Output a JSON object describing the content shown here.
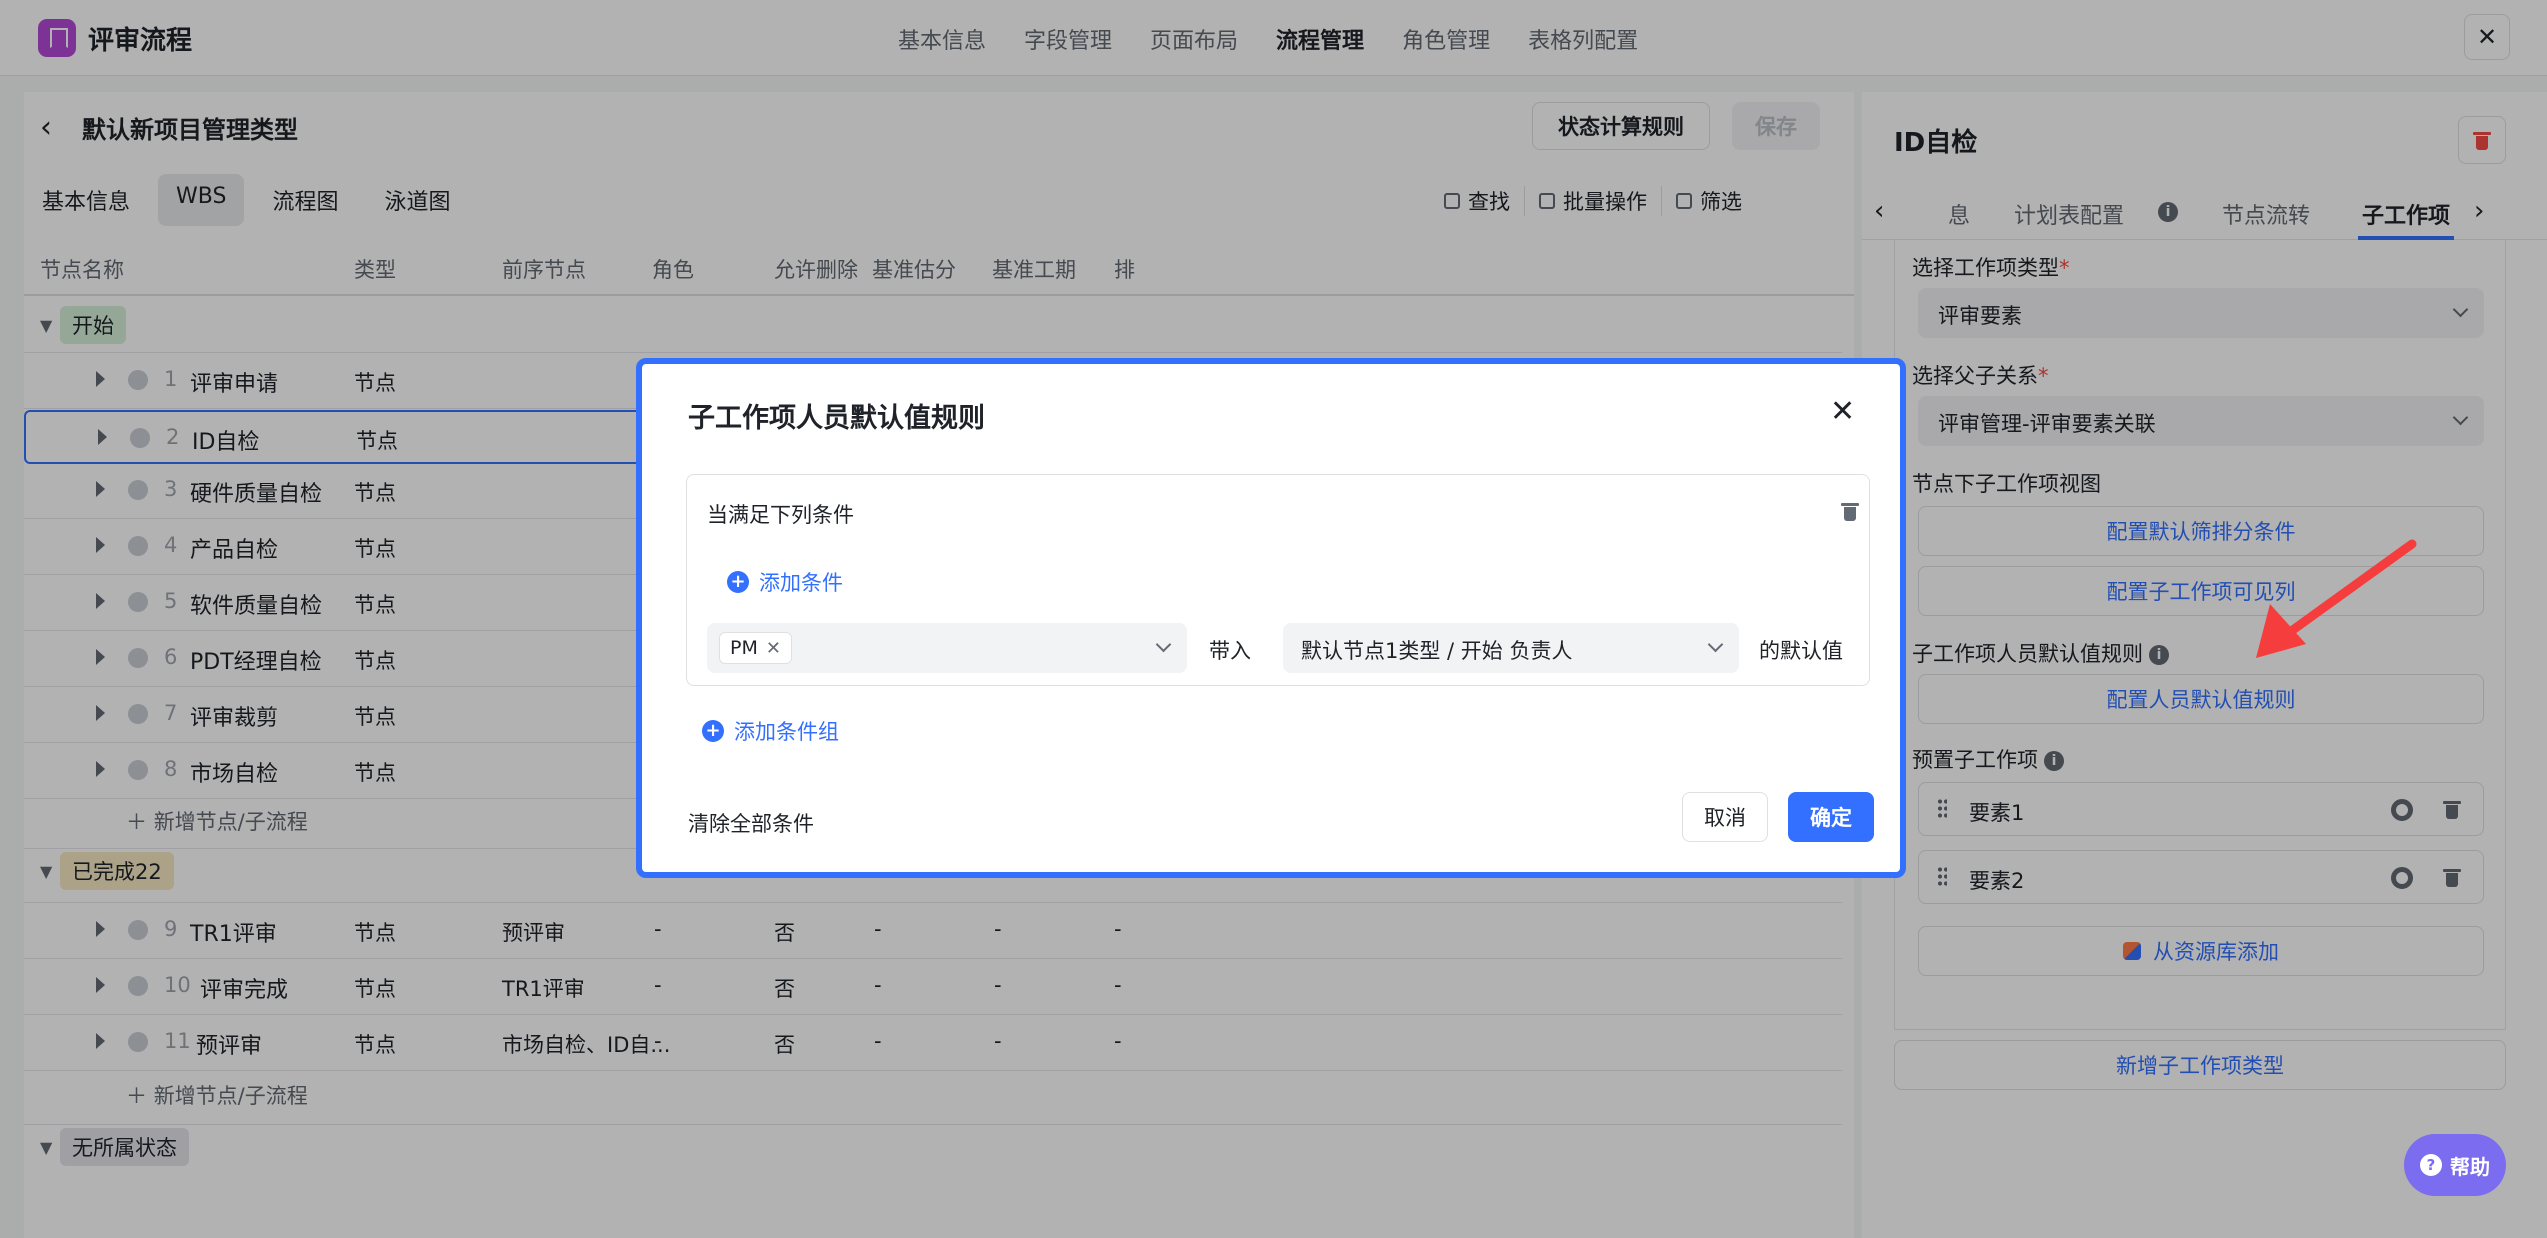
{
  "app": {
    "title": "评审流程"
  },
  "top_nav": [
    "基本信息",
    "字段管理",
    "页面布局",
    "流程管理",
    "角色管理",
    "表格列配置"
  ],
  "top_nav_active": "流程管理",
  "left": {
    "page_title": "默认新项目管理类型",
    "btn_calc": "状态计算规则",
    "btn_save": "保存",
    "tabs": [
      "基本信息",
      "WBS",
      "流程图",
      "泳道图"
    ],
    "tab_active": "WBS",
    "tools": {
      "find": "查找",
      "batch": "批量操作",
      "filter": "筛选"
    },
    "columns": [
      "节点名称",
      "类型",
      "前序节点",
      "角色",
      "允许删除",
      "基准估分",
      "基准工期",
      "排"
    ],
    "groups": {
      "start": "开始",
      "done": "已完成22",
      "none": "无所属状态"
    },
    "rows_start": [
      {
        "num": "1",
        "name": "评审申请",
        "type": "节点"
      },
      {
        "num": "2",
        "name": "ID自检",
        "type": "节点"
      },
      {
        "num": "3",
        "name": "硬件质量自检",
        "type": "节点"
      },
      {
        "num": "4",
        "name": "产品自检",
        "type": "节点"
      },
      {
        "num": "5",
        "name": "软件质量自检",
        "type": "节点"
      },
      {
        "num": "6",
        "name": "PDT经理自检",
        "type": "节点"
      },
      {
        "num": "7",
        "name": "评审裁剪",
        "type": "节点"
      },
      {
        "num": "8",
        "name": "市场自检",
        "type": "节点"
      }
    ],
    "rows_done": [
      {
        "num": "9",
        "name": "TR1评审",
        "type": "节点",
        "prev": "预评审",
        "role": "-",
        "del": "否",
        "est": "-",
        "dur": "-",
        "sort": "-"
      },
      {
        "num": "10",
        "name": "评审完成",
        "type": "节点",
        "prev": "TR1评审",
        "role": "-",
        "del": "否",
        "est": "-",
        "dur": "-",
        "sort": "-"
      },
      {
        "num": "11",
        "name": "预评审",
        "type": "节点",
        "prev": "市场自检、ID自...",
        "role": "-",
        "del": "否",
        "est": "-",
        "dur": "-",
        "sort": "-"
      }
    ],
    "add_node": "新增节点/子流程"
  },
  "right": {
    "title": "ID自检",
    "tabs": [
      "息",
      "计划表配置",
      "节点流转",
      "子工作项"
    ],
    "tab_active": "子工作项",
    "label_type": "选择工作项类型",
    "value_type": "评审要素",
    "label_parent": "选择父子关系",
    "value_parent": "评审管理-评审要素关联",
    "label_view": "节点下子工作项视图",
    "btn_filter": "配置默认筛排分条件",
    "btn_visible": "配置子工作项可见列",
    "label_rule": "子工作项人员默认值规则",
    "btn_rule": "配置人员默认值规则",
    "label_preset": "预置子工作项",
    "presets": [
      "要素1",
      "要素2"
    ],
    "btn_lib": "从资源库添加",
    "btn_new": "新增子工作项类型"
  },
  "modal": {
    "title": "子工作项人员默认值规则",
    "cond_title": "当满足下列条件",
    "add_condition": "添加条件",
    "role_chip": "PM",
    "bring_in": "带入",
    "field_value": "默认节点1类型 / 开始 负责人",
    "default_suffix": "的默认值",
    "add_group": "添加条件组",
    "clear_all": "清除全部条件",
    "cancel": "取消",
    "ok": "确定"
  },
  "help": {
    "label": "帮助"
  },
  "colors": {
    "accent": "#3370ff",
    "danger": "#f54a45",
    "help": "#7b6cf0"
  }
}
